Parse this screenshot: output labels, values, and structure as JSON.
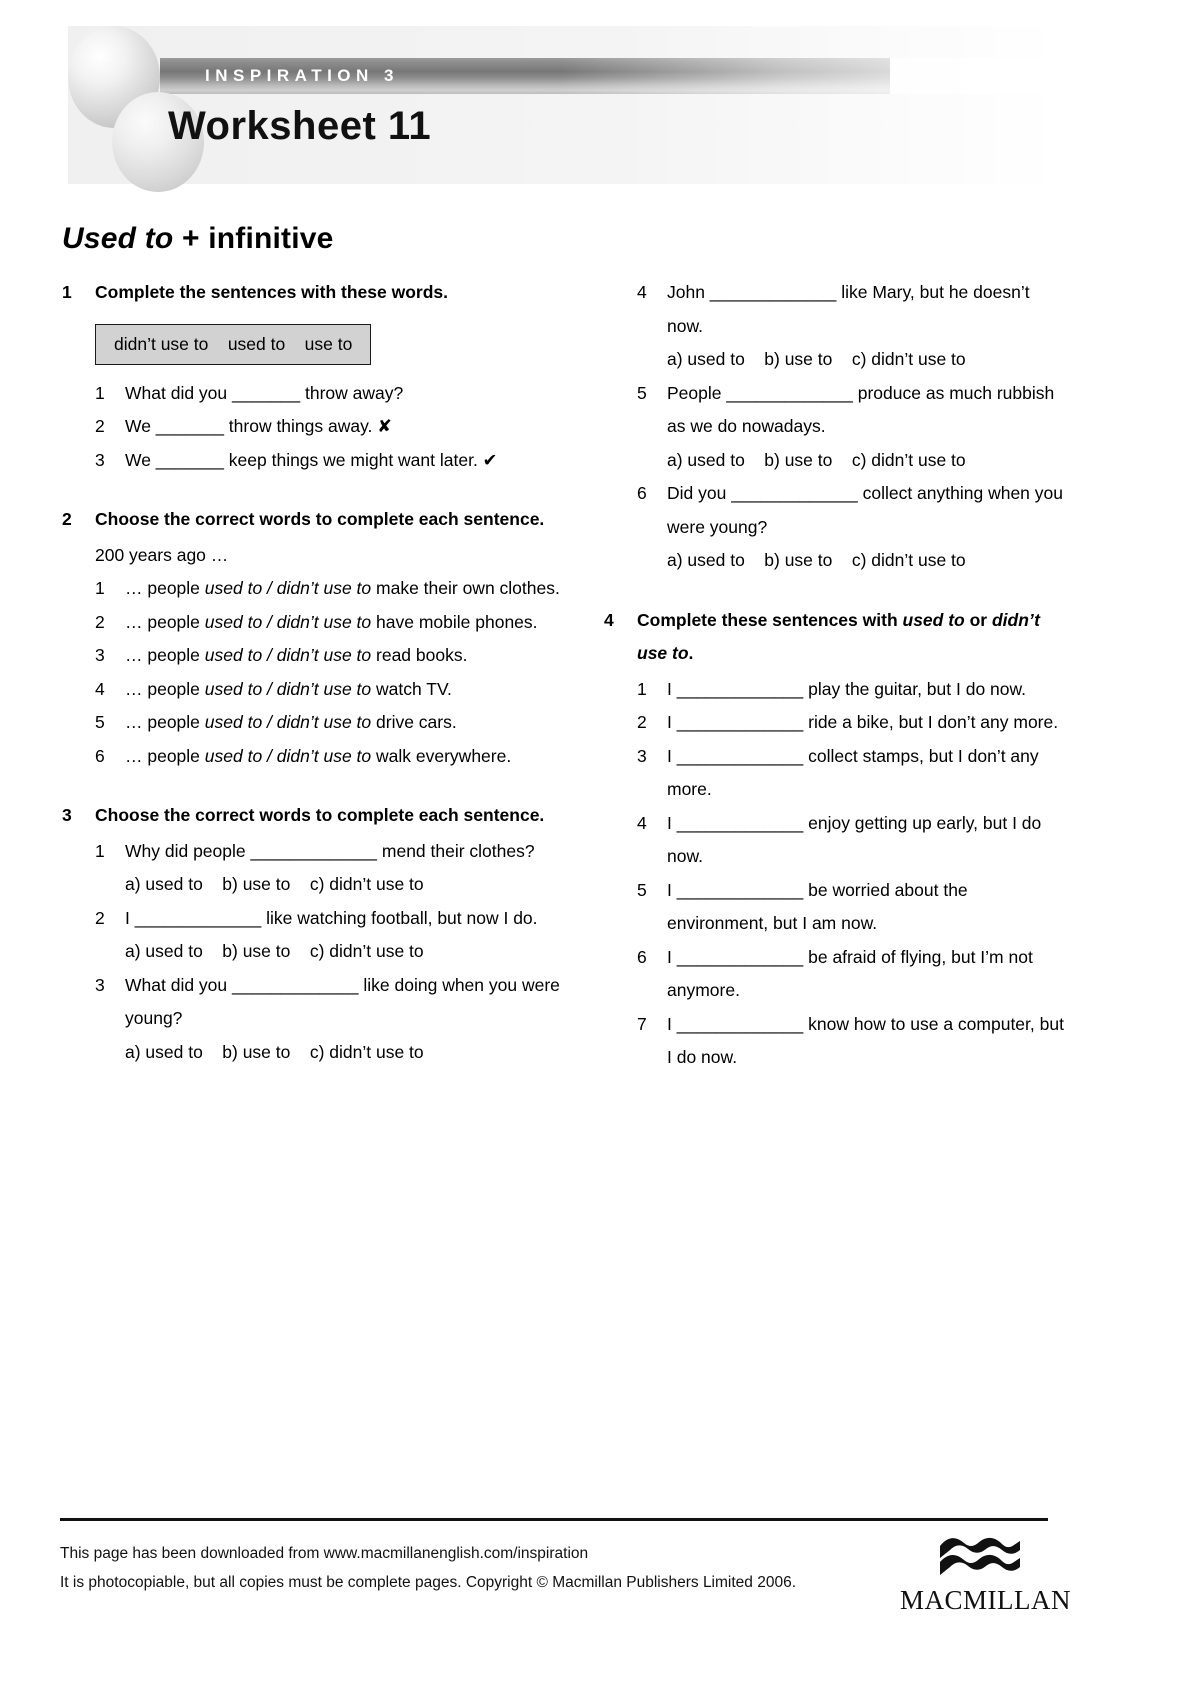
{
  "header": {
    "series_label": "INSPIRATION 3",
    "worksheet_title": "Worksheet 11"
  },
  "page_title": {
    "italic_part": "Used to",
    "rest_part": " + infinitive"
  },
  "exercises": {
    "ex1": {
      "number": "1",
      "title": "Complete the sentences with these words.",
      "word_box": "didn’t use to    used to    use to",
      "items": [
        {
          "num": "1",
          "text": "What did you _______ throw away?"
        },
        {
          "num": "2",
          "text": "We _______ throw things away. ✘"
        },
        {
          "num": "3",
          "text": "We _______ keep things we might want later. ✔"
        }
      ]
    },
    "ex2": {
      "number": "2",
      "title": "Choose the correct words to complete each sentence.",
      "lead": "200 years ago …",
      "items": [
        {
          "num": "1",
          "pre": "… people ",
          "choice": "used to / didn’t use to",
          "post": " make their own clothes."
        },
        {
          "num": "2",
          "pre": "… people ",
          "choice": "used to / didn’t use to",
          "post": " have mobile phones."
        },
        {
          "num": "3",
          "pre": "… people ",
          "choice": "used to / didn’t use to",
          "post": " read books."
        },
        {
          "num": "4",
          "pre": "… people ",
          "choice": "used to / didn’t use to",
          "post": " watch TV."
        },
        {
          "num": "5",
          "pre": "… people ",
          "choice": "used to / didn’t use to",
          "post": " drive cars."
        },
        {
          "num": "6",
          "pre": "… people ",
          "choice": "used to / didn’t use to",
          "post": " walk everywhere."
        }
      ]
    },
    "ex3": {
      "number": "3",
      "title": "Choose the correct words to complete each sentence.",
      "options": "a) used to    b) use to    c) didn’t use to",
      "items": [
        {
          "num": "1",
          "text": "Why did people _____________ mend their clothes?"
        },
        {
          "num": "2",
          "text": "I _____________ like watching football, but now I do."
        },
        {
          "num": "3",
          "text": "What did you _____________ like doing when you were young?"
        },
        {
          "num": "4",
          "text": "John _____________ like Mary, but he doesn’t now."
        },
        {
          "num": "5",
          "text": "People _____________ produce as much rubbish as we do nowadays."
        },
        {
          "num": "6",
          "text": "Did you _____________ collect anything when you were young?"
        }
      ]
    },
    "ex4": {
      "number": "4",
      "title_pre": "Complete these sentences with ",
      "title_ital1": "used to",
      "title_mid": " or ",
      "title_ital2": "didn’t use to",
      "title_post": ".",
      "items": [
        {
          "num": "1",
          "text": "I _____________ play the guitar, but I do now."
        },
        {
          "num": "2",
          "text": "I _____________ ride a bike, but I don’t any more."
        },
        {
          "num": "3",
          "text": "I _____________ collect stamps, but I don’t any more."
        },
        {
          "num": "4",
          "text": "I _____________ enjoy getting up early, but I do now."
        },
        {
          "num": "5",
          "text": "I _____________ be worried about the environment, but I am now."
        },
        {
          "num": "6",
          "text": "I _____________ be afraid of flying, but I’m not anymore."
        },
        {
          "num": "7",
          "text": "I _____________ know how to use a computer, but I do now."
        }
      ]
    }
  },
  "footer": {
    "line1": "This page has been downloaded from www.macmillanenglish.com/inspiration",
    "line2": "It is photocopiable, but all copies must be complete pages. Copyright © Macmillan Publishers Limited 2006.",
    "logo_word": "MACMILLAN"
  }
}
